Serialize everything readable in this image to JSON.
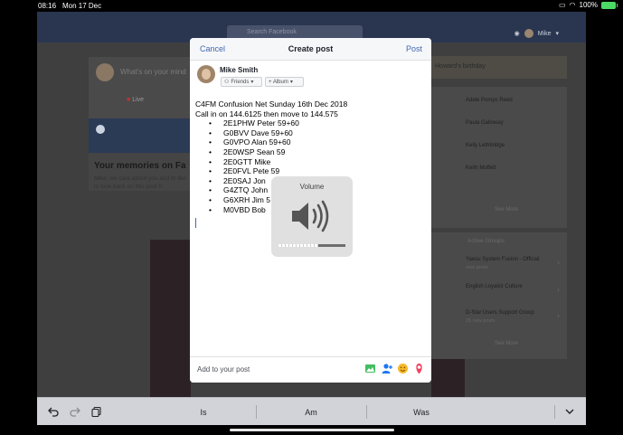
{
  "status_bar": {
    "time": "08:16",
    "date": "Mon 17 Dec",
    "battery": "100%"
  },
  "facebook": {
    "search_placeholder": "Search Facebook",
    "user_name": "Mike",
    "composer_placeholder": "What's on your mind",
    "live_label": "Live",
    "memories_title": "Your memories on Fa",
    "memories_body": "Mike, we care about you and th like to look back on this post fr",
    "birthday_text": "Howard's birthday",
    "friends": [
      "Adele Pomps Reed",
      "Paula Galloway",
      "Kelly Lethbridge",
      "Keith Moffett"
    ],
    "see_more_1": "See More",
    "active_groups_title": "Active Groups",
    "groups": [
      {
        "name": "Yaesu System Fusion - Official",
        "sub": "new posts"
      },
      {
        "name": "English Loyalist Culture",
        "sub": "new posts"
      },
      {
        "name": "D-Star Users Support Group",
        "sub": "25 new posts"
      }
    ],
    "see_more_2": "See More"
  },
  "modal": {
    "cancel": "Cancel",
    "title": "Create post",
    "post": "Post",
    "author": "Mike Smith",
    "audience": "Friends",
    "album": "+ Album",
    "line1": "C4FM Confusion Net Sunday 16th Dec 2018",
    "line2": "Call in on 144.6125 then move to 144.575",
    "items": [
      "2E1PHW Peter 59+60",
      "G0BVV Dave 59+60",
      "G0VPO Alan 59+60",
      "2E0WSP Sean 59",
      "2E0GTT Mike",
      "2E0FVL Pete 59",
      "2E0SAJ Jon",
      "G4ZTQ John",
      "G6XRH Jim 5",
      "M0VBD Bob"
    ],
    "add_to_post": "Add to your post"
  },
  "volume_hud": {
    "label": "Volume",
    "level": 0.6
  },
  "keyboard_bar": {
    "suggestions": [
      "Is",
      "Am",
      "Was"
    ]
  }
}
